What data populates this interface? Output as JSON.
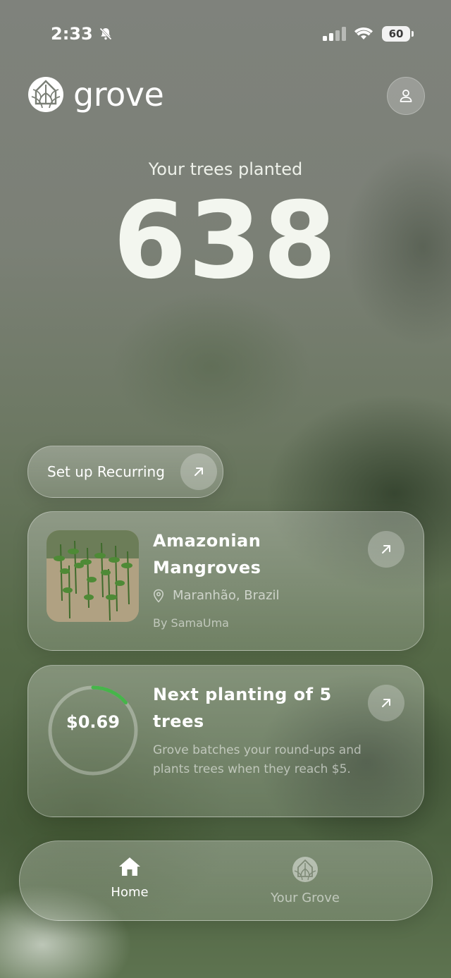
{
  "status_bar": {
    "time": "2:33",
    "battery": "60",
    "icons": [
      "bell-slash-icon",
      "signal-icon",
      "wifi-icon",
      "battery-icon"
    ]
  },
  "header": {
    "brand": "grove",
    "logo_icon": "grove-tree-logo",
    "profile_icon": "person-icon"
  },
  "hero": {
    "label": "Your trees planted",
    "count": "638"
  },
  "recurring": {
    "label": "Set up Recurring",
    "icon": "arrow-up-right-icon"
  },
  "project_card": {
    "title": "Amazonian Mangroves",
    "location": "Maranhão, Brazil",
    "author": "By SamaUma",
    "location_icon": "map-pin-icon",
    "arrow_icon": "arrow-up-right-icon"
  },
  "next_planting_card": {
    "amount": "$0.69",
    "progress_fraction": 0.138,
    "title": "Next planting of 5 trees",
    "description": "Grove batches your round-ups and plants trees when they reach $5.",
    "arrow_icon": "arrow-up-right-icon"
  },
  "nav": {
    "items": [
      {
        "label": "Home",
        "icon": "home-icon",
        "active": true
      },
      {
        "label": "Your Grove",
        "icon": "grove-tree-icon",
        "active": false
      }
    ]
  },
  "colors": {
    "progress": "#46b54a",
    "text": "#ffffff"
  }
}
